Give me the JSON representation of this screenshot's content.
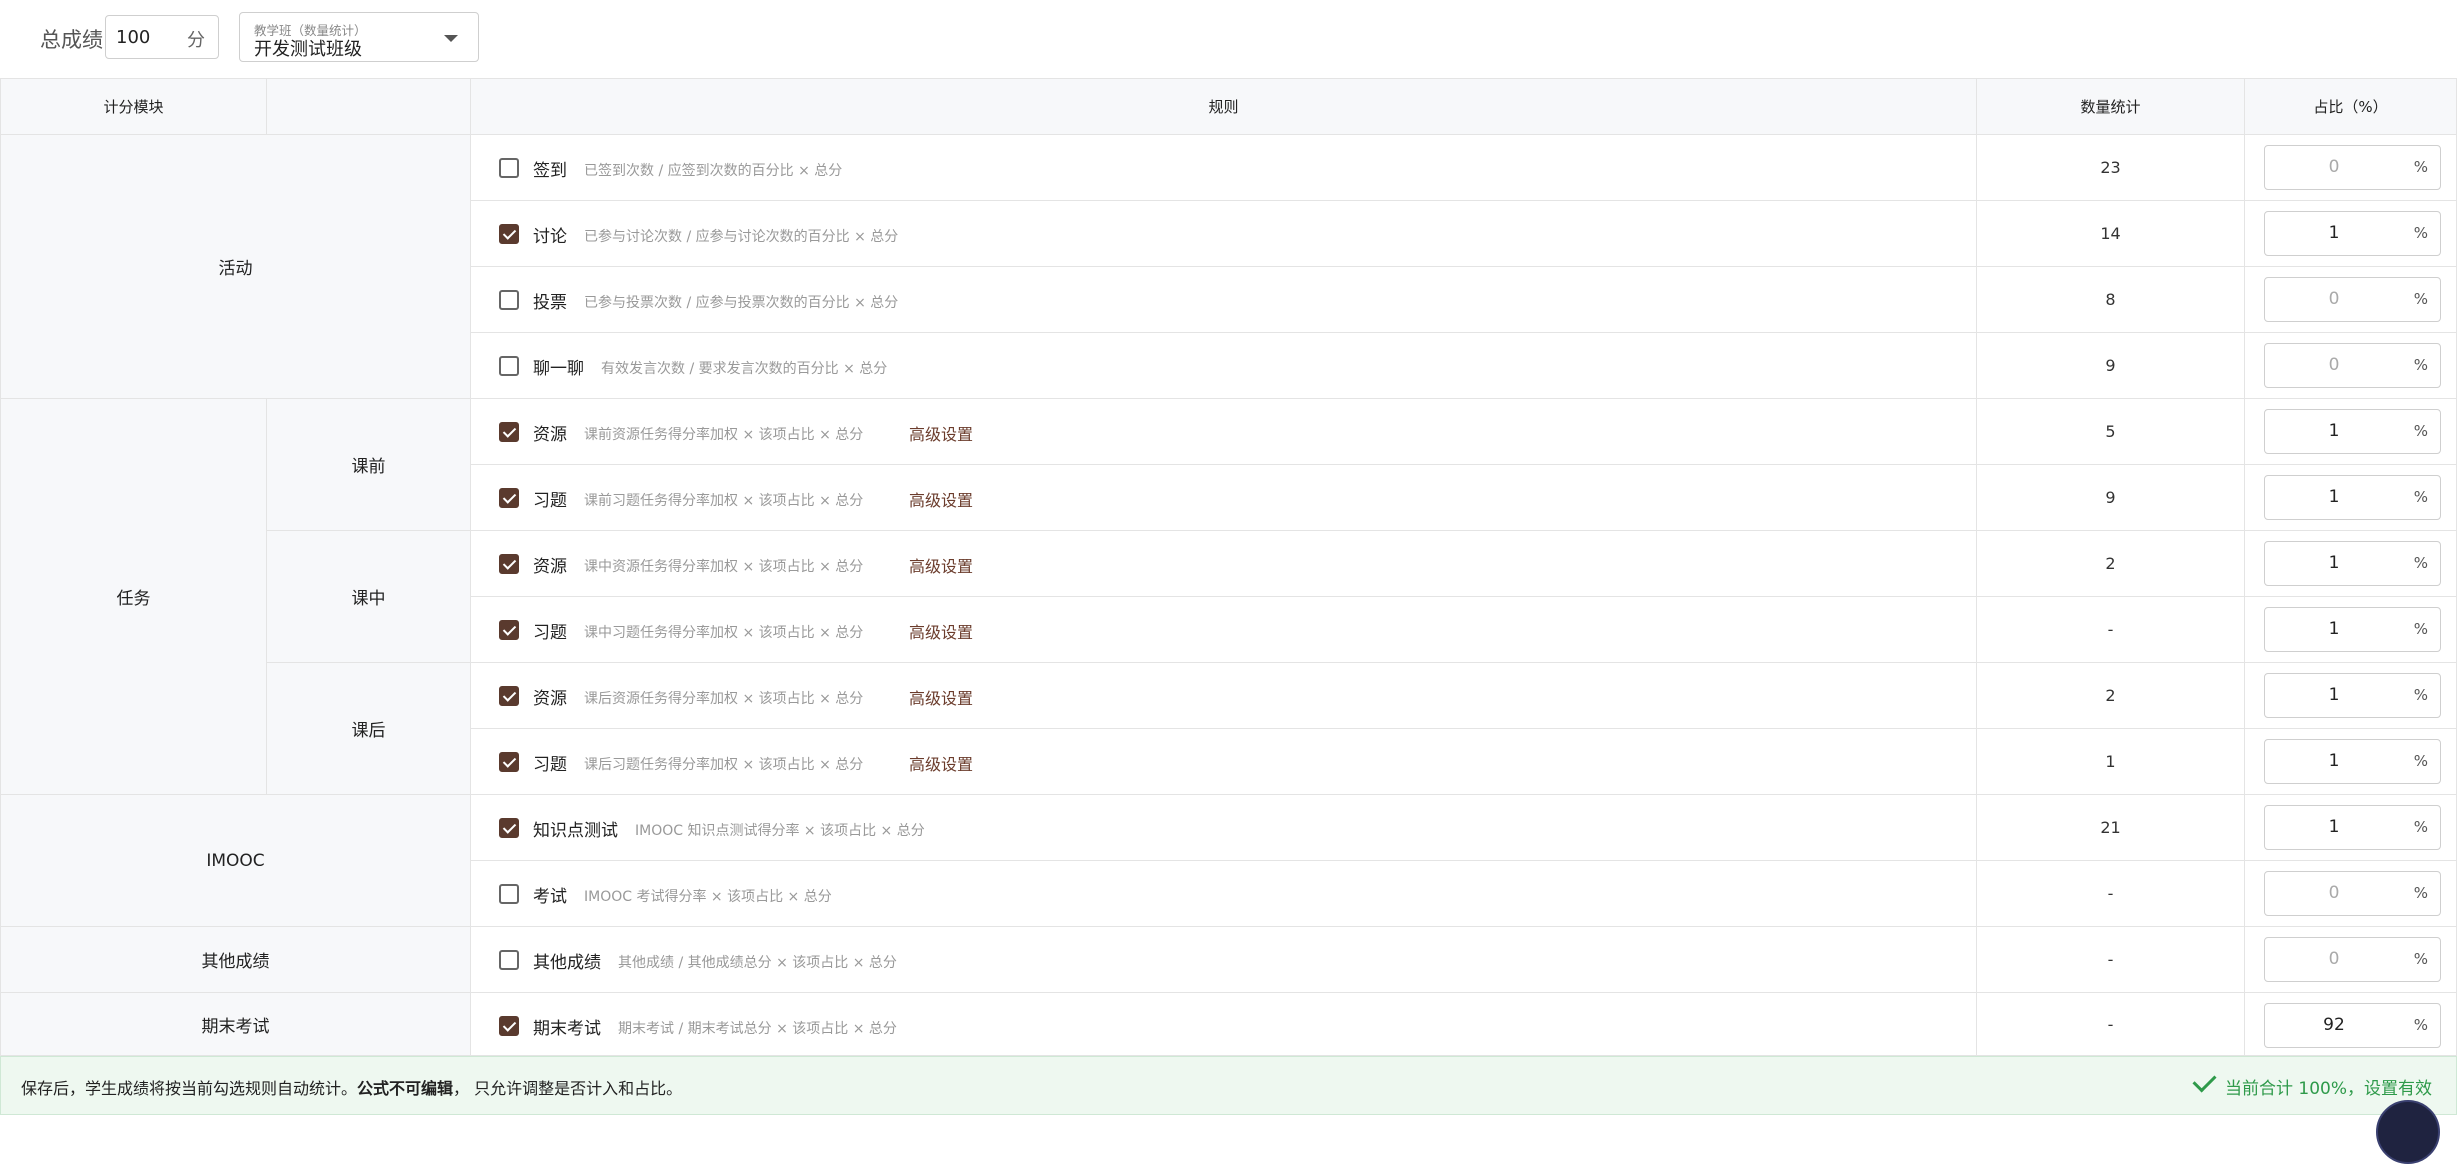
{
  "header": {
    "total_label": "总成绩",
    "total_value": "100",
    "total_unit": "分",
    "class_select_label": "教学班（数量统计）",
    "class_select_value": "开发测试班级"
  },
  "table": {
    "headers": {
      "module": "计分模块",
      "rule": "规则",
      "count": "数量统计",
      "ratio": "占比（%）"
    },
    "groups": {
      "activity": "活动",
      "task": "任务",
      "before": "课前",
      "during": "课中",
      "after": "课后",
      "imooc": "IMOOC",
      "other": "其他成绩",
      "final": "期末考试"
    },
    "advanced_label": "高级设置",
    "percent_sign": "%",
    "rows": [
      {
        "name": "签到",
        "formula": "已签到次数 / 应签到次数的百分比 × 总分",
        "checked": false,
        "count": "23",
        "ratio": "0",
        "advanced": false
      },
      {
        "name": "讨论",
        "formula": "已参与讨论次数 / 应参与讨论次数的百分比 × 总分",
        "checked": true,
        "count": "14",
        "ratio": "1",
        "advanced": false
      },
      {
        "name": "投票",
        "formula": "已参与投票次数 / 应参与投票次数的百分比 × 总分",
        "checked": false,
        "count": "8",
        "ratio": "0",
        "advanced": false
      },
      {
        "name": "聊一聊",
        "formula": "有效发言次数 / 要求发言次数的百分比 × 总分",
        "checked": false,
        "count": "9",
        "ratio": "0",
        "advanced": false
      },
      {
        "name": "资源",
        "formula": "课前资源任务得分率加权 × 该项占比 × 总分",
        "checked": true,
        "count": "5",
        "ratio": "1",
        "advanced": true
      },
      {
        "name": "习题",
        "formula": "课前习题任务得分率加权 × 该项占比 × 总分",
        "checked": true,
        "count": "9",
        "ratio": "1",
        "advanced": true
      },
      {
        "name": "资源",
        "formula": "课中资源任务得分率加权 × 该项占比 × 总分",
        "checked": true,
        "count": "2",
        "ratio": "1",
        "advanced": true
      },
      {
        "name": "习题",
        "formula": "课中习题任务得分率加权 × 该项占比 × 总分",
        "checked": true,
        "count": "-",
        "ratio": "1",
        "advanced": true
      },
      {
        "name": "资源",
        "formula": "课后资源任务得分率加权 × 该项占比 × 总分",
        "checked": true,
        "count": "2",
        "ratio": "1",
        "advanced": true
      },
      {
        "name": "习题",
        "formula": "课后习题任务得分率加权 × 该项占比 × 总分",
        "checked": true,
        "count": "1",
        "ratio": "1",
        "advanced": true
      },
      {
        "name": "知识点测试",
        "formula": "IMOOC 知识点测试得分率 × 该项占比 × 总分",
        "checked": true,
        "count": "21",
        "ratio": "1",
        "advanced": false
      },
      {
        "name": "考试",
        "formula": "IMOOC 考试得分率 × 该项占比 × 总分",
        "checked": false,
        "count": "-",
        "ratio": "0",
        "advanced": false
      },
      {
        "name": "其他成绩",
        "formula": "其他成绩 / 其他成绩总分 × 该项占比 × 总分",
        "checked": false,
        "count": "-",
        "ratio": "0",
        "advanced": false
      },
      {
        "name": "期末考试",
        "formula": "期末考试 / 期末考试总分 × 该项占比 × 总分",
        "checked": true,
        "count": "-",
        "ratio": "92",
        "advanced": false
      }
    ]
  },
  "footer": {
    "message_prefix": "保存后，学生成绩将按当前勾选规则自动统计。",
    "message_bold": "公式不可编辑",
    "message_suffix": "， 只允许调整是否计入和占比。",
    "status": "当前合计 100%，设置有效"
  },
  "colors": {
    "accent": "#5a3a2e",
    "link": "#6b3c2c",
    "success": "#2e9a4a"
  }
}
